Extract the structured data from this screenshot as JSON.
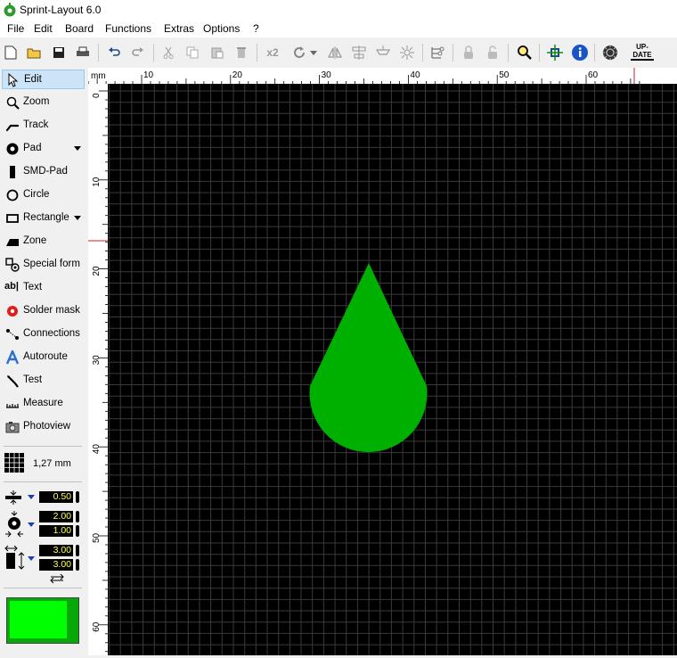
{
  "window": {
    "title": "Sprint-Layout 6.0"
  },
  "menu": [
    "File",
    "Edit",
    "Board",
    "Functions",
    "Extras",
    "Options",
    "?"
  ],
  "toolbar": {
    "x2_label": "x2",
    "update_label_1": "UP-",
    "update_label_2": "DATE",
    "buttons": [
      "new-icon",
      "open-icon",
      "save-icon",
      "print-icon",
      "undo-icon",
      "redo-icon",
      "cut-icon",
      "copy-icon",
      "paste-icon",
      "delete-icon",
      "duplicate-icon",
      "rotate-icon",
      "mirror-icon",
      "align-icon",
      "group-icon",
      "ungroup-icon",
      "properties-icon",
      "lock-icon",
      "unlock-icon",
      "zoom-icon",
      "crosshair-icon",
      "info-icon",
      "pcb-icon",
      "update-icon"
    ]
  },
  "tools": [
    {
      "label": "Edit",
      "icon": "pointer-icon",
      "active": true
    },
    {
      "label": "Zoom",
      "icon": "magnifier-icon"
    },
    {
      "label": "Track",
      "icon": "track-icon"
    },
    {
      "label": "Pad",
      "icon": "pad-icon",
      "dropdown": true
    },
    {
      "label": "SMD-Pad",
      "icon": "smd-pad-icon"
    },
    {
      "label": "Circle",
      "icon": "circle-icon"
    },
    {
      "label": "Rectangle",
      "icon": "rectangle-icon",
      "dropdown": true
    },
    {
      "label": "Zone",
      "icon": "zone-icon"
    },
    {
      "label": "Special form",
      "icon": "special-form-icon"
    },
    {
      "label": "Text",
      "icon": "text-icon"
    },
    {
      "label": "Solder mask",
      "icon": "solder-mask-icon"
    },
    {
      "label": "Connections",
      "icon": "connections-icon"
    },
    {
      "label": "Autoroute",
      "icon": "autoroute-icon"
    },
    {
      "label": "Test",
      "icon": "test-icon"
    },
    {
      "label": "Measure",
      "icon": "measure-icon"
    },
    {
      "label": "Photoview",
      "icon": "photoview-icon"
    }
  ],
  "grid": {
    "value": "1,27 mm"
  },
  "params": {
    "track_width": "0.50",
    "pad_outer": "2.00",
    "pad_inner": "1.00",
    "smd_width": "3.00",
    "smd_height": "3.00"
  },
  "ruler": {
    "unit": "mm",
    "top_labels": [
      "10",
      "20",
      "30",
      "40",
      "50",
      "60"
    ],
    "left_labels": [
      "0",
      "10",
      "20",
      "30",
      "40",
      "50",
      "60"
    ]
  },
  "colors": {
    "canvas": "#000000",
    "grid_line": "#3a3a3a",
    "grid_major": "#5a5a5a",
    "shape_fill": "#00b000",
    "swatch_outer": "#08a808",
    "swatch_inner": "#00ff00"
  }
}
